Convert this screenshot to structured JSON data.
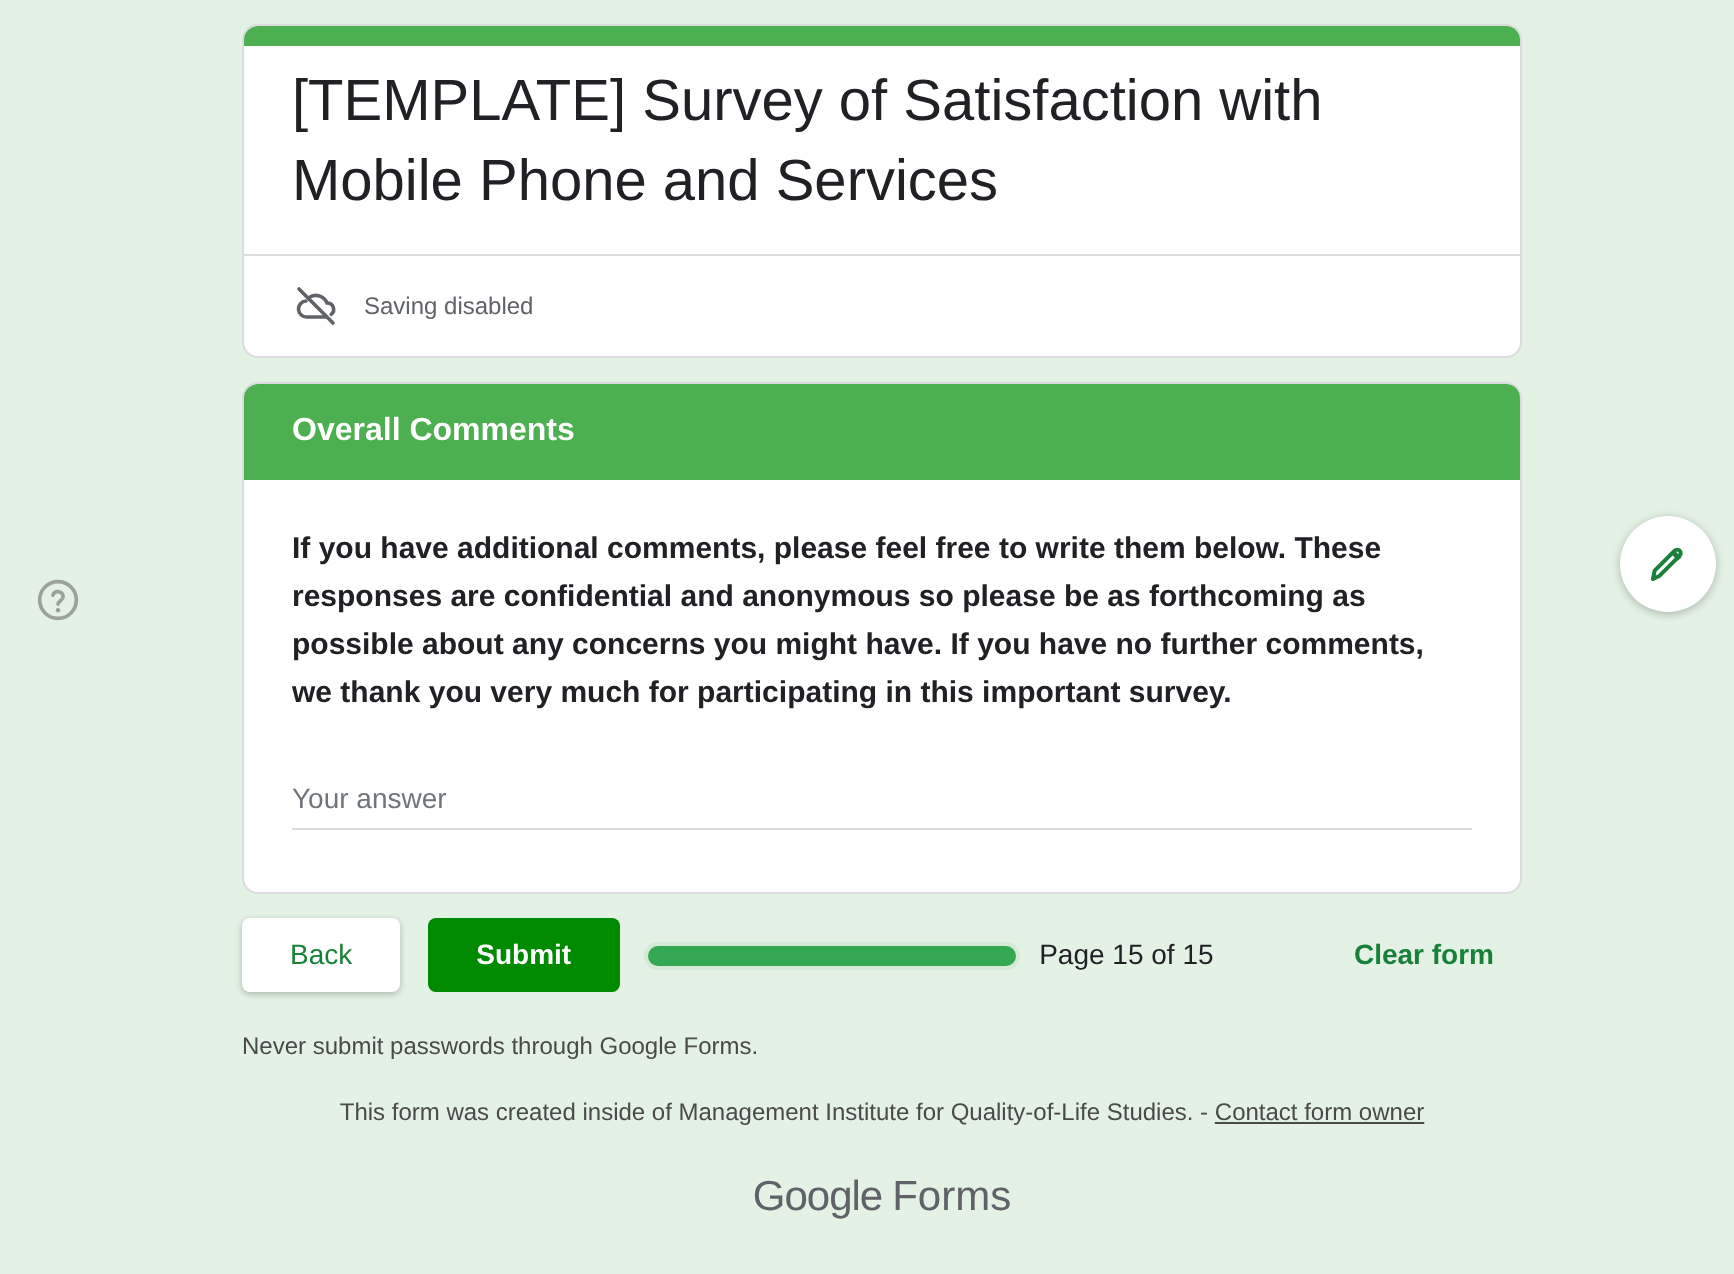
{
  "header": {
    "title": "[TEMPLATE] Survey of Satisfaction with Mobile Phone and Services",
    "saving_status": "Saving disabled"
  },
  "section": {
    "title": "Overall Comments",
    "description": "If you have additional comments, please feel free to write them below. These responses are confidential and anonymous so please be as forthcoming as possible about any concerns you might have. If you have no further comments, we thank you very much for participating in this important survey.",
    "answer": {
      "placeholder": "Your answer"
    }
  },
  "navigation": {
    "buttons": [
      {
        "label": "Back",
        "kind": "secondary"
      },
      {
        "label": "Submit",
        "kind": "primary"
      }
    ],
    "progress": {
      "level": 1
    },
    "page_label": "Page 15 of 15",
    "clear_button": "Clear form"
  },
  "footer": {
    "warning": "Never submit passwords through Google Forms.",
    "origin_text": "This form was created inside of Management Institute for Quality-of-Life Studies. -",
    "contact_link": "Contact form owner",
    "brand": [
      "Google",
      "Forms"
    ]
  }
}
